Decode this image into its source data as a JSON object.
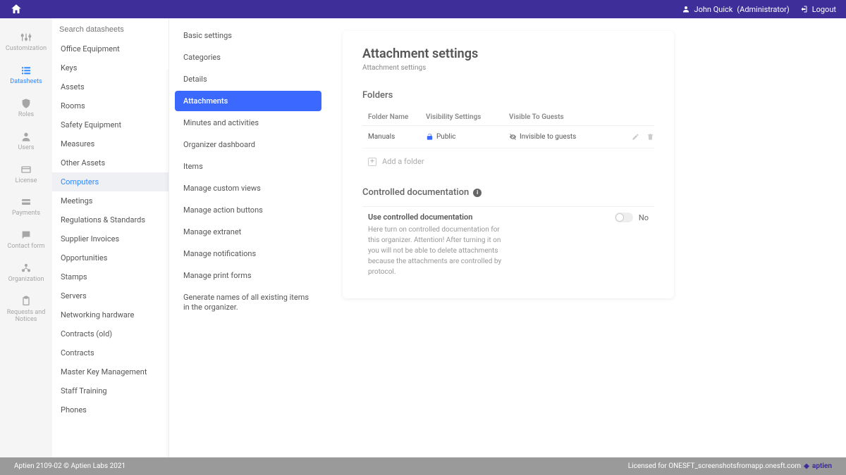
{
  "topbar": {
    "user_name": "John Quick",
    "user_role": "(Administrator)",
    "logout": "Logout"
  },
  "iconrail": [
    {
      "label": "Customization",
      "icon": "sliders"
    },
    {
      "label": "Datasheets",
      "icon": "list",
      "active": true
    },
    {
      "label": "Roles",
      "icon": "shield"
    },
    {
      "label": "Users",
      "icon": "user"
    },
    {
      "label": "License",
      "icon": "card"
    },
    {
      "label": "Payments",
      "icon": "credit"
    },
    {
      "label": "Contact form",
      "icon": "chat"
    },
    {
      "label": "Organization",
      "icon": "org"
    },
    {
      "label": "Requests and Notices",
      "icon": "clipboard"
    }
  ],
  "datasheets": {
    "search_placeholder": "Search datasheets",
    "items": [
      "Office Equipment",
      "Keys",
      "Assets",
      "Rooms",
      "Safety Equipment",
      "Measures",
      "Other Assets",
      "Computers",
      "Meetings",
      "Regulations & Standards",
      "Supplier Invoices",
      "Opportunities",
      "Stamps",
      "Servers",
      "Networking hardware",
      "Contracts (old)",
      "Contracts",
      "Master Key Management",
      "Staff Training",
      "Phones"
    ],
    "active": "Computers"
  },
  "settings_menu": [
    "Basic settings",
    "Categories",
    "Details",
    "Attachments",
    "Minutes and activities",
    "Organizer dashboard",
    "Items",
    "Manage custom views",
    "Manage action buttons",
    "Manage extranet",
    "Manage notifications",
    "Manage print forms",
    "Generate names of all existing items in the organizer."
  ],
  "settings_active": "Attachments",
  "main": {
    "title": "Attachment settings",
    "subtitle": "Attachment settings",
    "folders_heading": "Folders",
    "table": {
      "headers": {
        "name": "Folder Name",
        "visibility": "Visibility Settings",
        "guests": "Visible To Guests"
      },
      "row": {
        "name": "Manuals",
        "visibility": "Public",
        "guests": "Invisible to guests"
      }
    },
    "add_folder": "Add a folder",
    "controlled_heading": "Controlled documentation",
    "toggle": {
      "label": "Use controlled documentation",
      "desc": "Here turn on controlled documentation for this organizer. Attention! After turning it on you will not be able to delete attachments because the attachments are controlled by protocol.",
      "value": "No"
    }
  },
  "footer": {
    "left": "Aptien 2109-02 © Aptien Labs 2021",
    "right": "Licensed for ONESFT_screenshotsfromapp.onesft.com",
    "brand": "aptien"
  }
}
